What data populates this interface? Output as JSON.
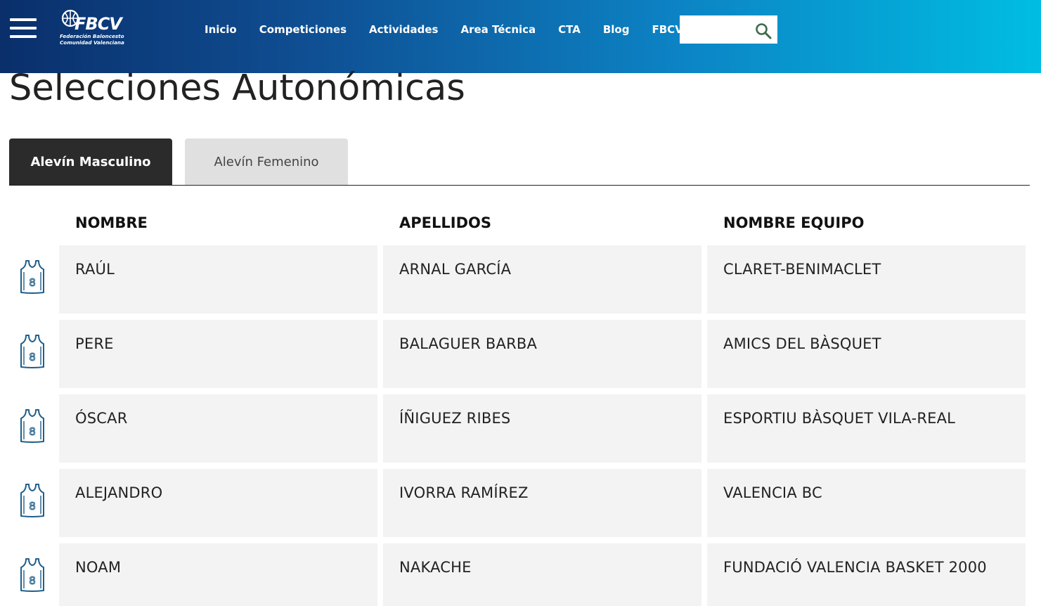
{
  "header": {
    "logo_main": "FBCV",
    "logo_sub_line1": "Federación Baloncesto",
    "logo_sub_line2": "Comunidad Valenciana",
    "nav": [
      "Inicio",
      "Competiciones",
      "Actividades",
      "Area Técnica",
      "CTA",
      "Blog",
      "FBCV"
    ],
    "search_value": ""
  },
  "page_title": "Selecciones Autonómicas",
  "tabs": [
    {
      "label": "Alevín Masculino",
      "active": true
    },
    {
      "label": "Alevín Femenino",
      "active": false
    }
  ],
  "table": {
    "headers": [
      "NOMBRE",
      "APELLIDOS",
      "NOMBRE EQUIPO"
    ],
    "rows": [
      {
        "jersey_number": "8",
        "nombre": "RAÚL",
        "apellidos": "ARNAL GARCÍA",
        "equipo": "CLARET-BENIMACLET"
      },
      {
        "jersey_number": "8",
        "nombre": "PERE",
        "apellidos": "BALAGUER BARBA",
        "equipo": "AMICS DEL BÀSQUET"
      },
      {
        "jersey_number": "8",
        "nombre": "ÓSCAR",
        "apellidos": "ÍÑIGUEZ RIBES",
        "equipo": "ESPORTIU BÀSQUET VILA-REAL"
      },
      {
        "jersey_number": "8",
        "nombre": "ALEJANDRO",
        "apellidos": "IVORRA RAMÍREZ",
        "equipo": "VALENCIA BC"
      },
      {
        "jersey_number": "8",
        "nombre": "NOAM",
        "apellidos": "NAKACHE",
        "equipo": "FUNDACIÓ VALENCIA BASKET 2000"
      }
    ]
  },
  "colors": {
    "header_gradient_start": "#0a2f6b",
    "header_gradient_end": "#00bde3",
    "tab_active_bg": "#2b2b2b",
    "tab_inactive_bg": "#e0e0e0",
    "cell_bg": "#f3f3f3",
    "jersey_icon": "#1f5f8b"
  },
  "icons": {
    "menu": "hamburger-icon",
    "search": "search-icon",
    "row": "jersey-icon"
  }
}
